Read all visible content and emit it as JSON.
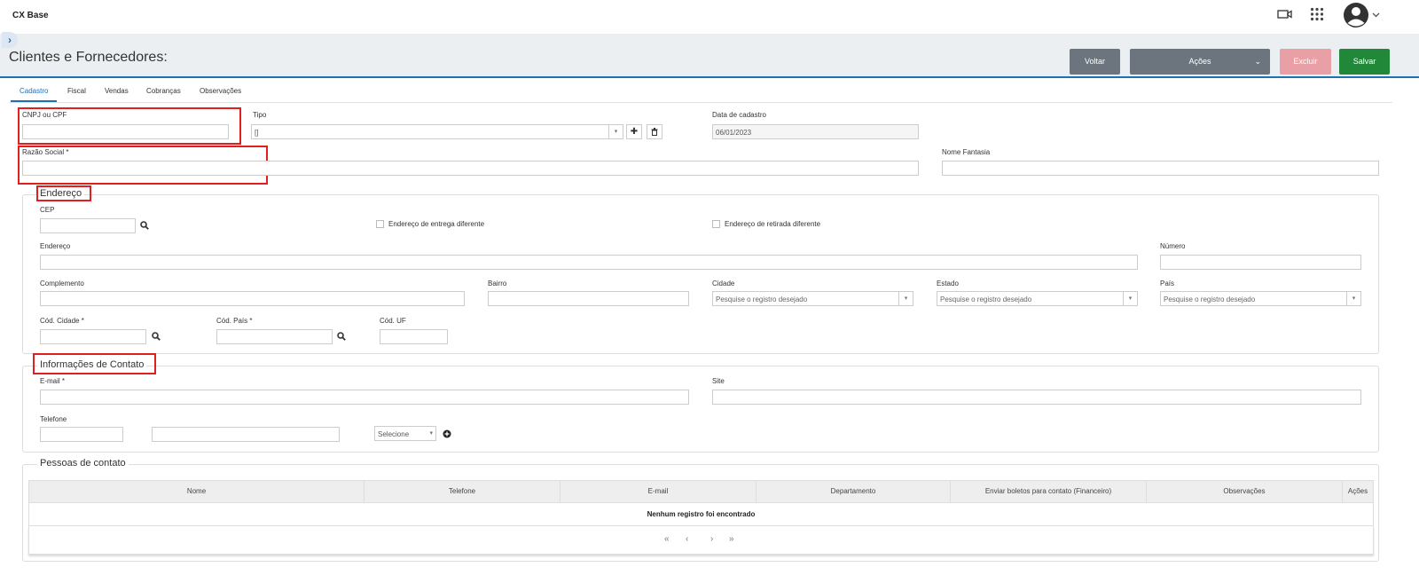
{
  "app": {
    "title": "CX Base"
  },
  "header": {
    "page_title": "Clientes e Fornecedores:"
  },
  "actions": {
    "voltar": "Voltar",
    "acoes": "Ações",
    "excluir": "Excluir",
    "salvar": "Salvar"
  },
  "tabs": [
    {
      "label": "Cadastro",
      "active": true
    },
    {
      "label": "Fiscal"
    },
    {
      "label": "Vendas"
    },
    {
      "label": "Cobranças"
    },
    {
      "label": "Observações"
    }
  ],
  "cadastro": {
    "cnpj_label": "CNPJ ou CPF",
    "cnpj_value": "",
    "tipo_label": "Tipo",
    "tipo_value": "[]",
    "data_label": "Data de cadastro",
    "data_value": "06/01/2023",
    "razao_label": "Razão Social *",
    "nome_fantasia_label": "Nome Fantasia"
  },
  "endereco": {
    "legend": "Endereço",
    "cep_label": "CEP",
    "entrega_label": "Endereço de entrega diferente",
    "retirada_label": "Endereço de retirada diferente",
    "endereco_label": "Endereço",
    "numero_label": "Número",
    "complemento_label": "Complemento",
    "bairro_label": "Bairro",
    "cidade_label": "Cidade",
    "cidade_placeholder": "Pesquise o registro desejado",
    "estado_label": "Estado",
    "estado_placeholder": "Pesquise o registro desejado",
    "pais_label": "País",
    "pais_placeholder": "Pesquise o registro desejado",
    "cod_cidade_label": "Cód. Cidade *",
    "cod_pais_label": "Cód. País *",
    "cod_uf_label": "Cód. UF"
  },
  "contato": {
    "legend": "Informações de Contato",
    "email_label": "E-mail *",
    "site_label": "Site",
    "telefone_label": "Telefone",
    "tipo_tel_value": "Selecione"
  },
  "pessoas": {
    "legend": "Pessoas de contato",
    "columns": [
      "Nome",
      "Telefone",
      "E-mail",
      "Departamento",
      "Enviar boletos para contato (Financeiro)",
      "Observações",
      "Ações"
    ],
    "empty_message": "Nenhum registro foi encontrado"
  },
  "icons": {
    "video": "video-camera-icon",
    "apps": "apps-grid-icon",
    "user": "user-avatar-icon",
    "search": "search-icon",
    "plus": "plus-icon",
    "trash": "trash-icon"
  },
  "colors": {
    "primary": "#1f6fb5",
    "secondary": "#6c757d",
    "danger_disabled": "#e8a0a6",
    "success": "#208838",
    "highlight": "#e02020"
  }
}
